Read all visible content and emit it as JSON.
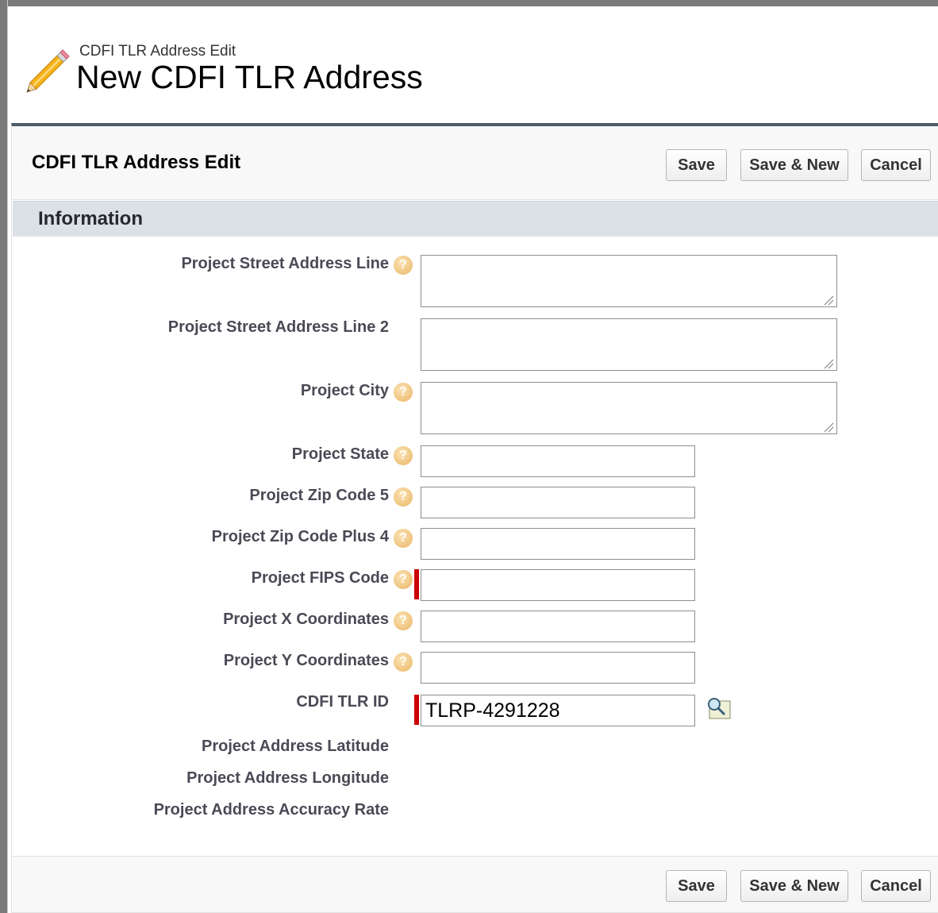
{
  "header": {
    "subtitle": "CDFI TLR Address Edit",
    "title": "New CDFI TLR Address"
  },
  "edit_block": {
    "title": "CDFI TLR Address Edit",
    "buttons": {
      "save": "Save",
      "save_new": "Save & New",
      "cancel": "Cancel"
    }
  },
  "section": {
    "title": "Information"
  },
  "fields": {
    "street1": {
      "label": "Project Street Address Line",
      "value": ""
    },
    "street2": {
      "label": "Project Street Address Line 2",
      "value": ""
    },
    "city": {
      "label": "Project City",
      "value": ""
    },
    "state": {
      "label": "Project State",
      "value": ""
    },
    "zip5": {
      "label": "Project Zip Code 5",
      "value": ""
    },
    "zip4": {
      "label": "Project Zip Code Plus 4",
      "value": ""
    },
    "fips": {
      "label": "Project FIPS Code",
      "value": ""
    },
    "xcoord": {
      "label": "Project X Coordinates",
      "value": ""
    },
    "ycoord": {
      "label": "Project Y Coordinates",
      "value": ""
    },
    "tlrid": {
      "label": "CDFI TLR ID",
      "value": "TLRP-4291228"
    },
    "latitude": {
      "label": "Project Address Latitude"
    },
    "longitude": {
      "label": "Project Address Longitude"
    },
    "accuracy": {
      "label": "Project Address Accuracy Rate"
    }
  },
  "colors": {
    "accent_bar": "#4c5b68",
    "section_bg": "#dbe1e7",
    "required": "#cc0000",
    "help_icon": "#e9b566"
  },
  "icons": [
    "pencil-icon",
    "help-icon",
    "lookup-icon"
  ]
}
